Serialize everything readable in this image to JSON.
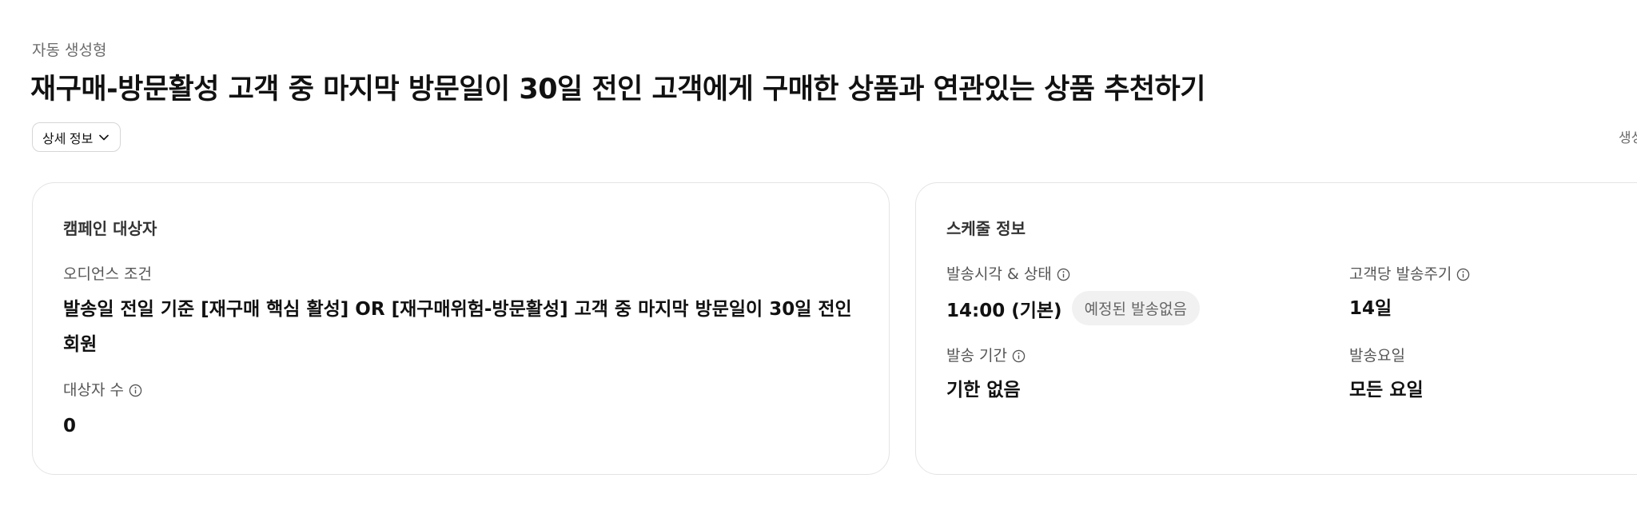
{
  "header": {
    "eyebrow": "자동 생성형",
    "title": "재구매-방문활성 고객 중 마지막 방문일이 30일 전인 고객에게 구매한 상품과 연관있는 상품 추천하기",
    "detail_button_label": "상세 정보",
    "detail_button_icon": "chevron-down-icon",
    "right_meta_partial": "생성"
  },
  "target_card": {
    "title": "캠페인 대상자",
    "audience_label": "오디언스 조건",
    "audience_value_line1": "발송일 전일 기준 [재구매 핵심 활성] OR [재구매위험-방문활성] 고객 중 마지막 방문일이 30일 전인",
    "audience_value_line2": "회원",
    "count_label": "대상자 수",
    "count_value": "0"
  },
  "schedule_card": {
    "title": "스케줄 정보",
    "send_time_label": "발송시각 & 상태",
    "send_time_value": "14:00 (기본)",
    "send_status_badge": "예정된 발송없음",
    "cycle_label": "고객당 발송주기",
    "cycle_value": "14일",
    "period_label": "발송 기간",
    "period_value": "기한 없음",
    "weekday_label": "발송요일",
    "weekday_value": "모든 요일"
  },
  "colors": {
    "text_primary": "#111111",
    "text_secondary": "#555555",
    "border": "#e4e4e4",
    "badge_bg": "#f1f1f1"
  }
}
